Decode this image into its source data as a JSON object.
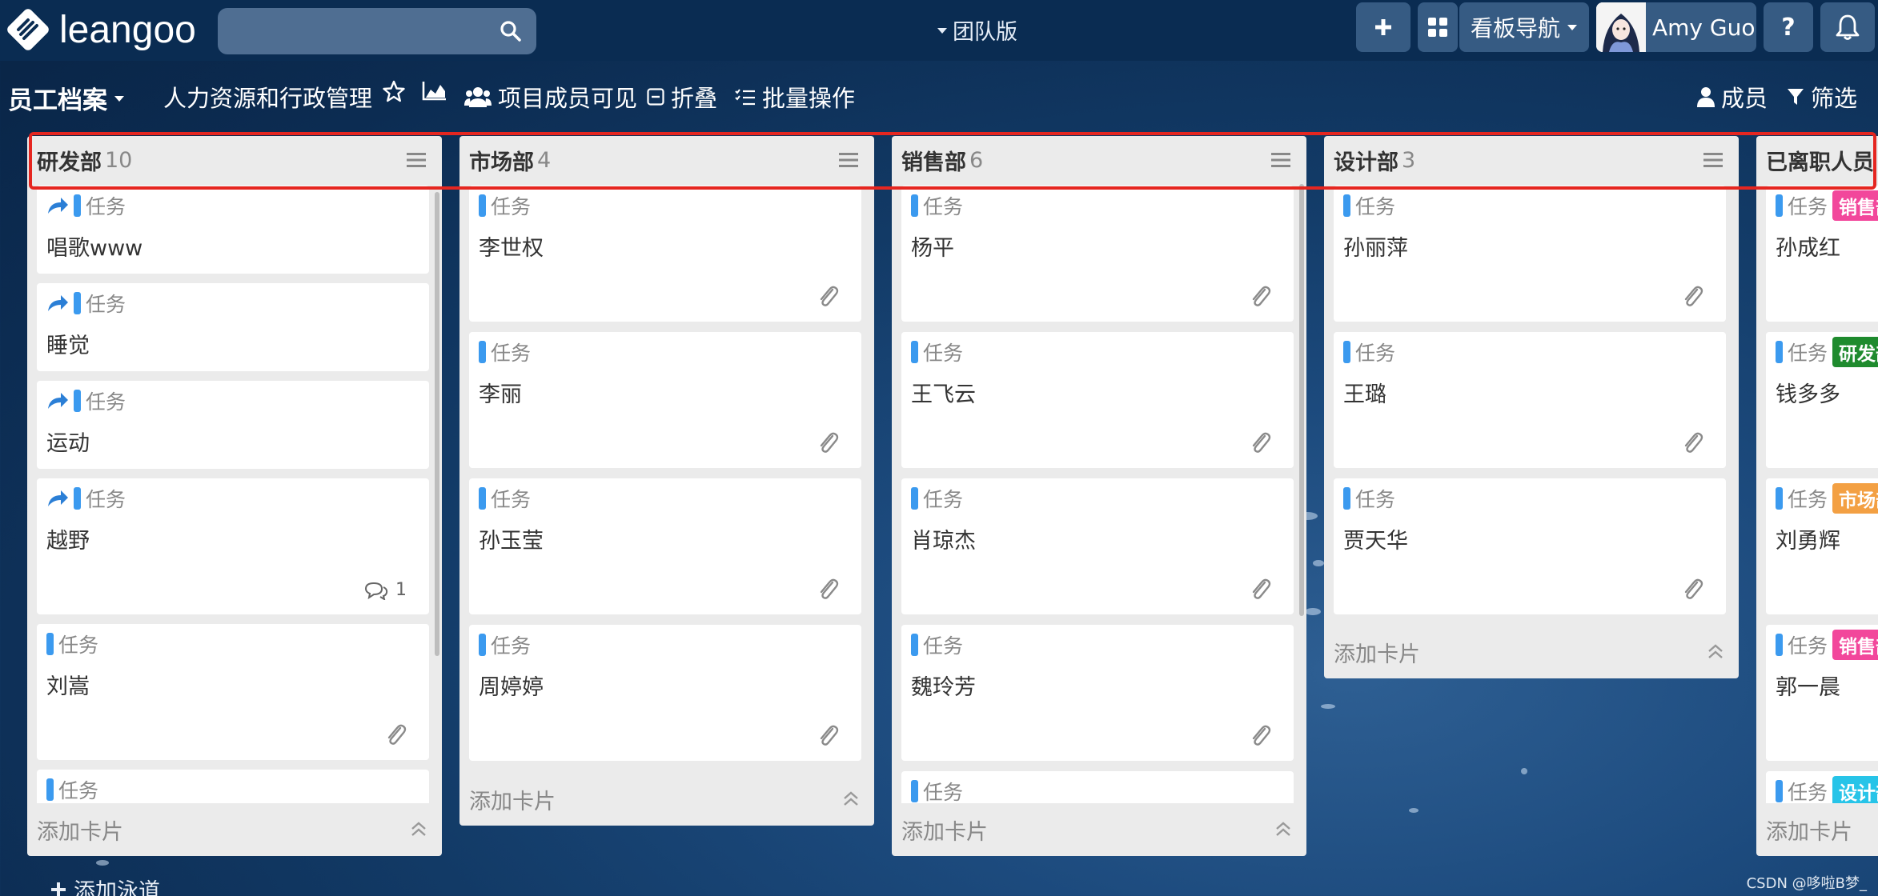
{
  "topbar": {
    "logo_text": "leangoo",
    "search_placeholder": "",
    "edition_label": "团队版",
    "board_nav_label": "看板导航",
    "user_name": "Amy Guo",
    "help_label": "?"
  },
  "board": {
    "title": "员工档案",
    "project": "人力资源和行政管理",
    "visibility": "项目成员可见",
    "collapse": "折叠",
    "batch": "批量操作",
    "members": "成员",
    "filter": "筛选"
  },
  "lanes": [
    {
      "title": "研发部",
      "count": "10",
      "footer": "添加卡片",
      "cards": [
        {
          "type": "任务",
          "name": "唱歌www"
        },
        {
          "type": "任务",
          "name": "睡觉"
        },
        {
          "type": "任务",
          "name": "运动"
        },
        {
          "type": "任务",
          "name": "越野",
          "comments": "1"
        },
        {
          "type": "任务",
          "name": "刘嵩"
        },
        {
          "type": "任务",
          "name": ""
        }
      ]
    },
    {
      "title": "市场部",
      "count": "4",
      "footer": "添加卡片",
      "cards": [
        {
          "type": "任务",
          "name": "李世权"
        },
        {
          "type": "任务",
          "name": "李丽"
        },
        {
          "type": "任务",
          "name": "孙玉莹"
        },
        {
          "type": "任务",
          "name": "周婷婷"
        }
      ]
    },
    {
      "title": "销售部",
      "count": "6",
      "footer": "添加卡片",
      "cards": [
        {
          "type": "任务",
          "name": "杨平"
        },
        {
          "type": "任务",
          "name": "王飞云"
        },
        {
          "type": "任务",
          "name": "肖琼杰"
        },
        {
          "type": "任务",
          "name": "魏玲芳"
        },
        {
          "type": "任务",
          "name": ""
        }
      ]
    },
    {
      "title": "设计部",
      "count": "3",
      "footer": "添加卡片",
      "cards": [
        {
          "type": "任务",
          "name": "孙丽萍"
        },
        {
          "type": "任务",
          "name": "王璐"
        },
        {
          "type": "任务",
          "name": "贾天华"
        }
      ]
    },
    {
      "title": "已离职人员",
      "count": "",
      "footer": "添加卡片",
      "cards": [
        {
          "type": "任务",
          "name": "孙成红",
          "tag": "销售部"
        },
        {
          "type": "任务",
          "name": "钱多多",
          "tag": "研发部"
        },
        {
          "type": "任务",
          "name": "刘勇辉",
          "tag": "市场部"
        },
        {
          "type": "任务",
          "name": "郭一晨",
          "tag": "销售部"
        },
        {
          "type": "任务",
          "name": "",
          "tag": "设计部"
        }
      ]
    }
  ],
  "colors": {
    "accent_bar": "#3b9aef",
    "highlight": "#e52620",
    "tag_sales": "#f2479b",
    "tag_rd": "#1f8b2e",
    "tag_market": "#f3a043",
    "tag_design": "#27c4e8"
  },
  "add_lane": "添加泳道",
  "watermark": "CSDN @哆啦B梦_"
}
